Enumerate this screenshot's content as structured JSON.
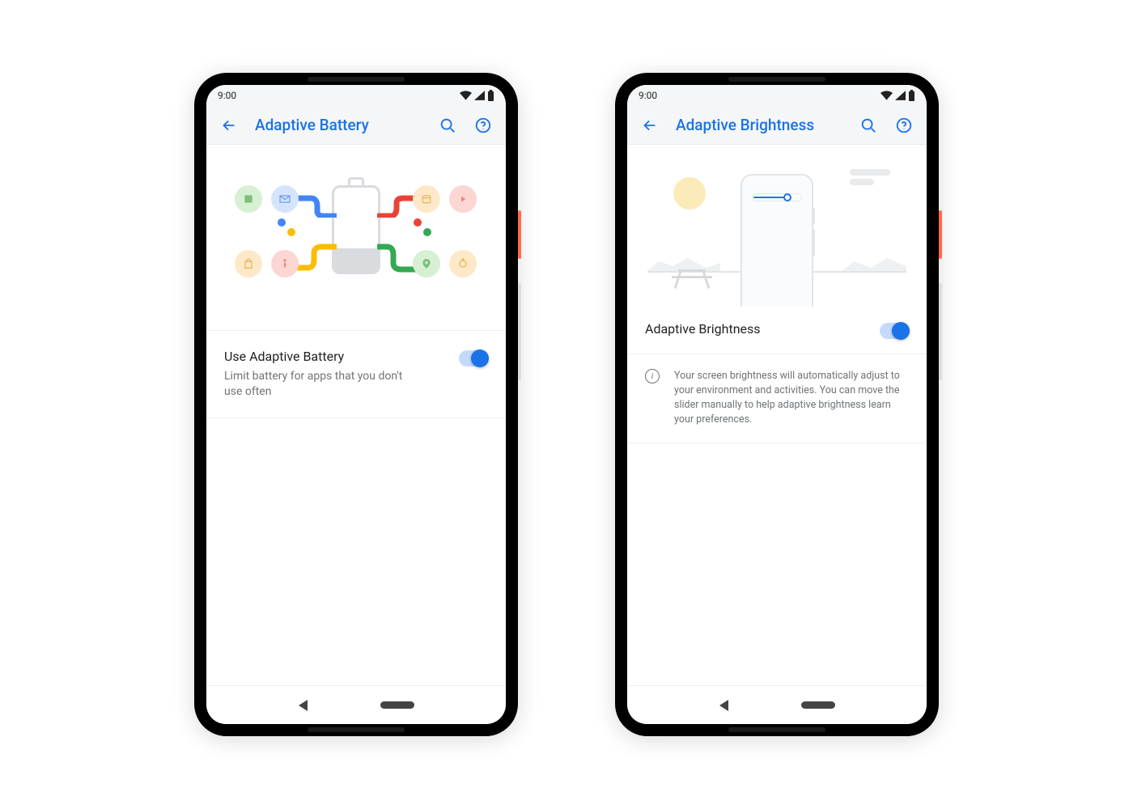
{
  "status_time": "9:00",
  "phones": [
    {
      "title": "Adaptive Battery",
      "setting_label": "Use Adaptive Battery",
      "setting_sub": "Limit battery for apps that you don't use often",
      "toggle_on": true
    },
    {
      "title": "Adaptive Brightness",
      "setting_label": "Adaptive Brightness",
      "toggle_on": true,
      "info_text": "Your screen brightness will automatically adjust to your environment and activities. You can move the slider manually to help adaptive brightness learn your preferences."
    }
  ],
  "colors": {
    "accent": "#1a73e8",
    "google_blue": "#4285F4",
    "google_red": "#EA4335",
    "google_yellow": "#FBBC05",
    "google_green": "#34A853"
  }
}
